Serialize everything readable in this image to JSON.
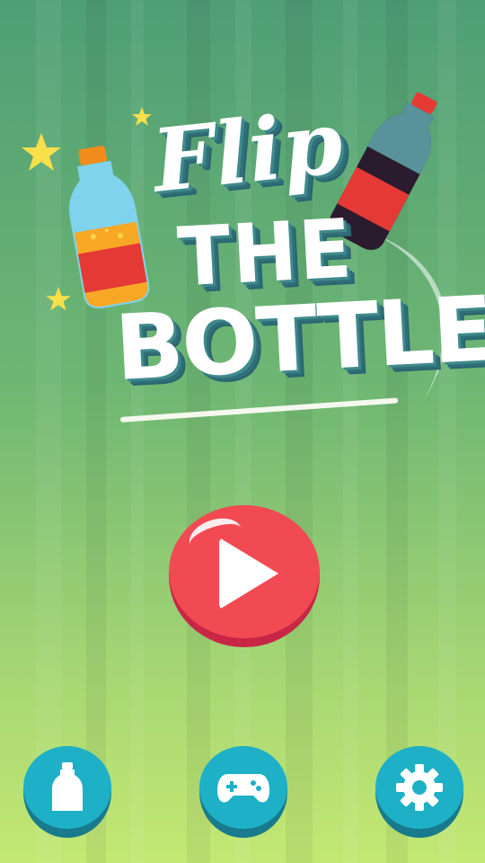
{
  "title": {
    "line1": "Flip",
    "line2": "THE",
    "line3": "BOTTLE"
  },
  "colors": {
    "background_top": "#4f9e76",
    "background_bottom": "#c3e873",
    "play_button": "#f24a52",
    "round_button": "#1eb0c6",
    "title_shadow": "#2f6f78"
  },
  "main": {
    "play_button": {
      "icon": "play-icon"
    }
  },
  "bottom_bar": {
    "buttons": [
      {
        "icon": "bottle-icon"
      },
      {
        "icon": "gamepad-icon"
      },
      {
        "icon": "gear-icon"
      }
    ]
  },
  "decor": {
    "left_bottle": "orange-bottle",
    "right_bottle": "cola-bottle",
    "stars": [
      "star",
      "star",
      "star"
    ]
  }
}
